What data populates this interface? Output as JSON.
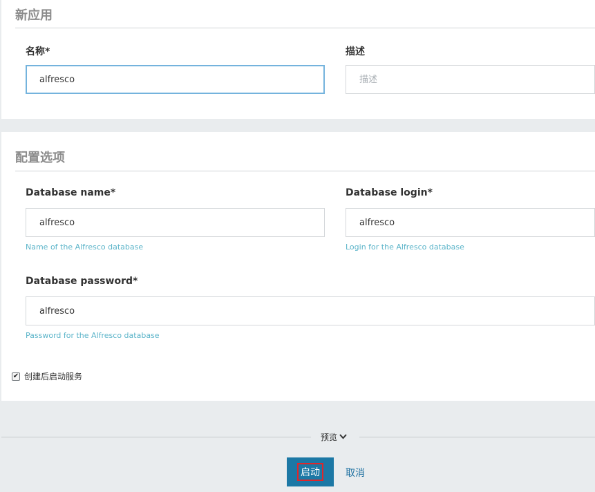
{
  "new_app": {
    "section_title": "新应用",
    "name_label": "名称*",
    "name_value": "alfresco",
    "description_label": "描述",
    "description_placeholder": "描述"
  },
  "config": {
    "section_title": "配置选项",
    "db_name_label": "Database name*",
    "db_name_value": "alfresco",
    "db_name_help": "Name of the Alfresco database",
    "db_login_label": "Database login*",
    "db_login_value": "alfresco",
    "db_login_help": "Login for the Alfresco database",
    "db_password_label": "Database password*",
    "db_password_value": "alfresco",
    "db_password_help": "Password for the Alfresco database",
    "start_after_create_label": "创建后启动服务",
    "start_after_create_checked": true
  },
  "preview": {
    "label": "预览",
    "icon": "chevron-down-icon"
  },
  "actions": {
    "start_label": "启动",
    "cancel_label": "取消"
  },
  "colors": {
    "primary_button": "#1c78a5",
    "focus_border": "#74b3dd",
    "help_text": "#5bb4c9",
    "highlight_border": "#e0262a"
  }
}
